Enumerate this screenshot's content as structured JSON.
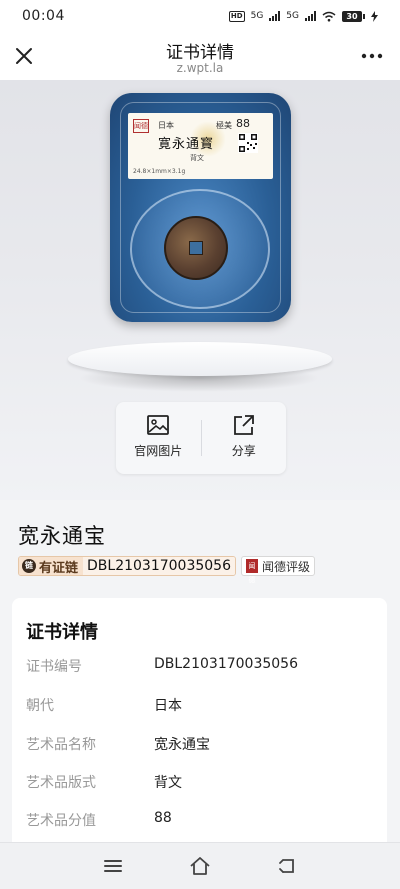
{
  "status_bar": {
    "time": "00:04",
    "network_1": "5G",
    "network_2": "5G",
    "hd_label": "HD",
    "battery": "30"
  },
  "title_bar": {
    "title": "证书详情",
    "subtitle": "z.wpt.la"
  },
  "slab_label": {
    "seal": "闻德",
    "country": "日本",
    "grade_word": "極美",
    "grade": "88",
    "coin_name": "寛永通寳",
    "style": "背文",
    "footer": "24.8×1mm×3.1g",
    "qr_code": "DBL2103170035056"
  },
  "actions": [
    {
      "label": "官网图片",
      "icon": "image-icon"
    },
    {
      "label": "分享",
      "icon": "share-icon"
    }
  ],
  "item": {
    "title": "宽永通宝",
    "chain_label": "有证链",
    "chain_icon_text": "链",
    "cert_number": "DBL2103170035056",
    "brand_logo": "闻德",
    "brand": "闻德评级"
  },
  "details": {
    "heading": "证书详情",
    "rows": [
      {
        "label": "证书编号",
        "value": "DBL2103170035056"
      },
      {
        "label": "朝代",
        "value": "日本"
      },
      {
        "label": "艺术品名称",
        "value": "宽永通宝"
      },
      {
        "label": "艺术品版式",
        "value": "背文"
      },
      {
        "label": "艺术品分值",
        "value": "88"
      }
    ]
  },
  "nav_bar": {
    "buttons": [
      "menu-icon",
      "home-icon",
      "back-icon"
    ]
  }
}
